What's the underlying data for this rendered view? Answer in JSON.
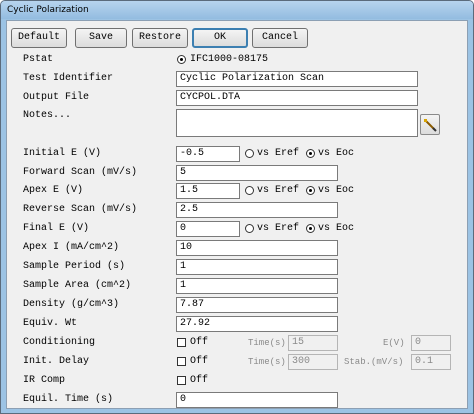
{
  "window": {
    "title": "Cyclic Polarization"
  },
  "toolbar": {
    "default_label": "Default",
    "save_label": "Save",
    "restore_label": "Restore",
    "ok_label": "OK",
    "cancel_label": "Cancel"
  },
  "form": {
    "pstat": {
      "label": "Pstat",
      "value": "IFC1000-08175",
      "selected": true
    },
    "test_identifier": {
      "label": "Test Identifier",
      "value": "Cyclic Polarization Scan"
    },
    "output_file": {
      "label": "Output File",
      "value": "CYCPOL.DTA"
    },
    "notes": {
      "label": "Notes...",
      "value": ""
    },
    "initial_e": {
      "label": "Initial E (V)",
      "value": "-0.5",
      "vs_eref": "vs Eref",
      "vs_eoc": "vs Eoc",
      "selected": "vs Eoc"
    },
    "forward_scan": {
      "label": "Forward Scan (mV/s)",
      "value": "5"
    },
    "apex_e": {
      "label": "Apex E (V)",
      "value": "1.5",
      "vs_eref": "vs Eref",
      "vs_eoc": "vs Eoc",
      "selected": "vs Eoc"
    },
    "reverse_scan": {
      "label": "Reverse Scan (mV/s)",
      "value": "2.5"
    },
    "final_e": {
      "label": "Final E (V)",
      "value": "0",
      "vs_eref": "vs Eref",
      "vs_eoc": "vs Eoc",
      "selected": "vs Eoc"
    },
    "apex_i": {
      "label": "Apex I (mA/cm^2)",
      "value": "10"
    },
    "sample_period": {
      "label": "Sample Period (s)",
      "value": "1"
    },
    "sample_area": {
      "label": "Sample Area (cm^2)",
      "value": "1"
    },
    "density": {
      "label": "Density (g/cm^3)",
      "value": "7.87"
    },
    "equiv_wt": {
      "label": "Equiv. Wt",
      "value": "27.92"
    },
    "conditioning": {
      "label": "Conditioning",
      "toggle": "Off",
      "time_label": "Time(s)",
      "time_value": "15",
      "e_label": "E(V)",
      "e_value": "0"
    },
    "init_delay": {
      "label": "Init. Delay",
      "toggle": "Off",
      "time_label": "Time(s)",
      "time_value": "300",
      "stab_label": "Stab.(mV/s)",
      "stab_value": "0.1"
    },
    "ir_comp": {
      "label": "IR Comp",
      "toggle": "Off"
    },
    "equil_time": {
      "label": "Equil. Time (s)",
      "value": "0"
    }
  }
}
